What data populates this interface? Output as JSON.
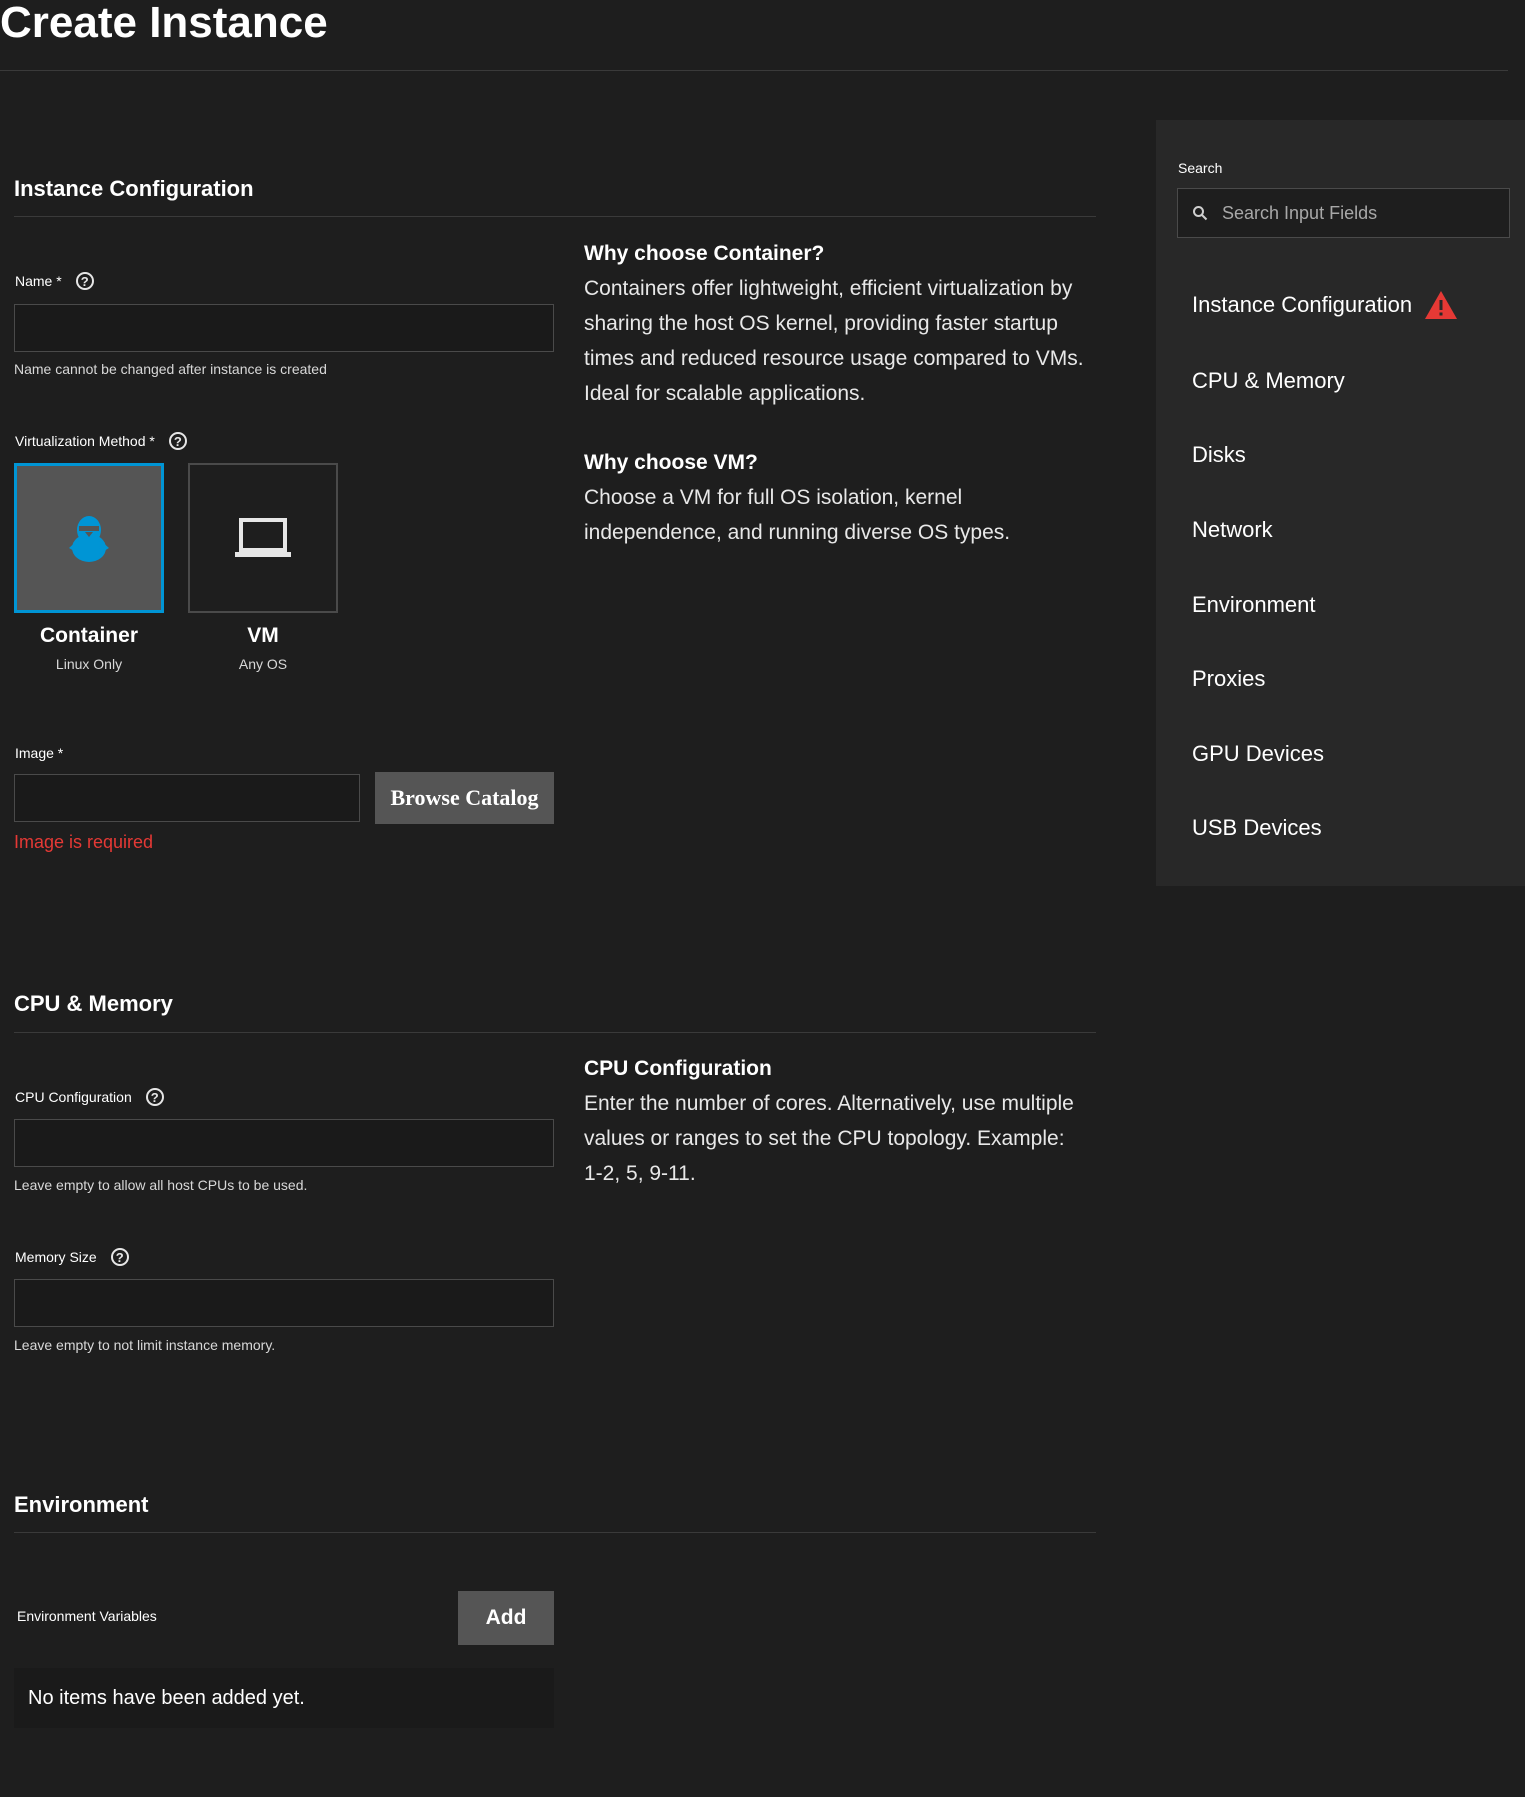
{
  "page": {
    "title": "Create Instance"
  },
  "instance_config": {
    "section_title": "Instance Configuration",
    "name_label": "Name *",
    "name_hint": "Name cannot be changed after instance is created",
    "name_value": "",
    "virt_label": "Virtualization Method *",
    "virt_options": [
      {
        "title": "Container",
        "subtitle": "Linux Only",
        "selected": true,
        "icon": "penguin-icon"
      },
      {
        "title": "VM",
        "subtitle": "Any OS",
        "selected": false,
        "icon": "laptop-icon"
      }
    ],
    "image_label": "Image *",
    "image_value": "",
    "browse_label": "Browse Catalog",
    "image_error": "Image is required",
    "help": {
      "container_heading": "Why choose Container?",
      "container_text": "Containers offer lightweight, efficient virtualization by sharing the host OS kernel, providing faster startup times and reduced resource usage compared to VMs. Ideal for scalable applications.",
      "vm_heading": "Why choose VM?",
      "vm_text": "Choose a VM for full OS isolation, kernel independence, and running diverse OS types."
    }
  },
  "cpu_memory": {
    "section_title": "CPU & Memory",
    "cpu_label": "CPU Configuration",
    "cpu_hint": "Leave empty to allow all host CPUs to be used.",
    "cpu_value": "",
    "memory_label": "Memory Size",
    "memory_hint": "Leave empty to not limit instance memory.",
    "memory_value": "",
    "help": {
      "heading": "CPU Configuration",
      "text": "Enter the number of cores. Alternatively, use multiple values or ranges to set the CPU topology. Example: 1-2, 5, 9-11."
    }
  },
  "environment": {
    "section_title": "Environment",
    "vars_label": "Environment Variables",
    "add_label": "Add",
    "empty_text": "No items have been added yet."
  },
  "sidebar": {
    "search_label": "Search",
    "search_placeholder": "Search Input Fields",
    "items": [
      {
        "label": "Instance Configuration",
        "warning": true
      },
      {
        "label": "CPU & Memory"
      },
      {
        "label": "Disks"
      },
      {
        "label": "Network"
      },
      {
        "label": "Environment"
      },
      {
        "label": "Proxies"
      },
      {
        "label": "GPU Devices"
      },
      {
        "label": "USB Devices"
      }
    ]
  },
  "colors": {
    "accent": "#0095d5",
    "error": "#e53935",
    "background": "#1e1e1e",
    "sidebar_bg": "#282828"
  }
}
